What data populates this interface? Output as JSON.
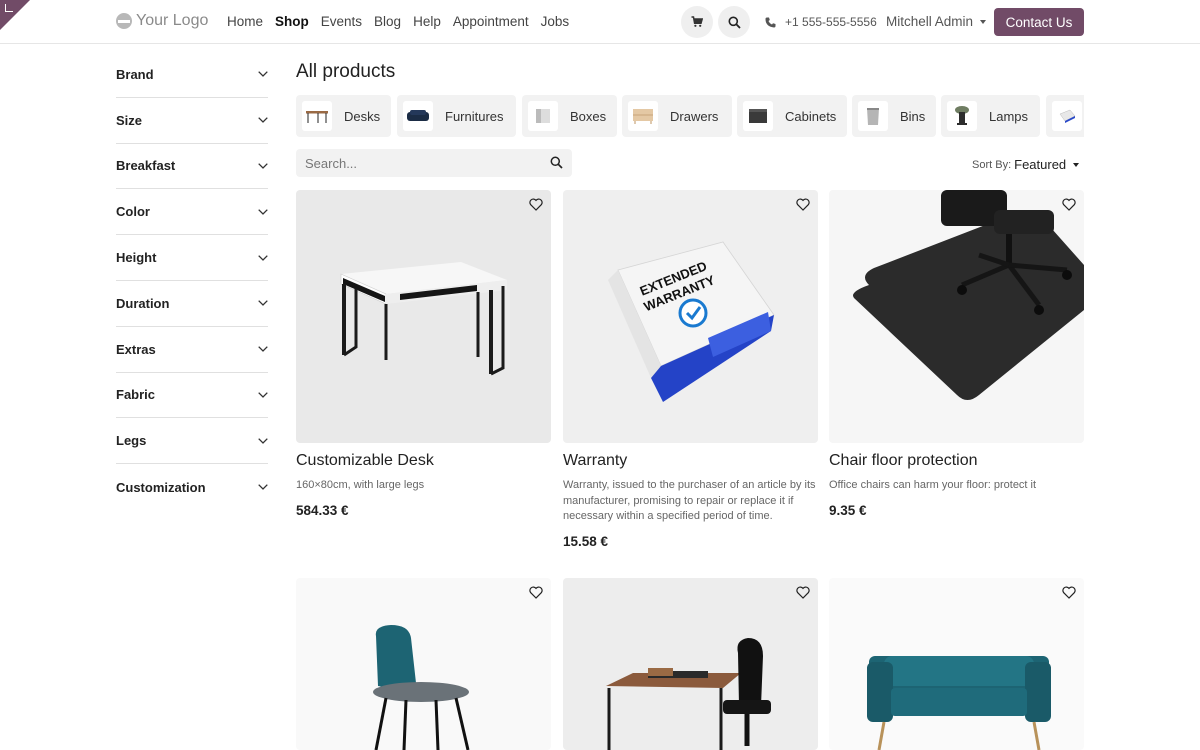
{
  "header": {
    "logo_text": "Your Logo",
    "nav": [
      "Home",
      "Shop",
      "Events",
      "Blog",
      "Help",
      "Appointment",
      "Jobs"
    ],
    "active_nav": "Shop",
    "phone": "+1 555-555-5556",
    "user": "Mitchell Admin",
    "contact_label": "Contact Us"
  },
  "filters": [
    "Brand",
    "Size",
    "Breakfast",
    "Color",
    "Height",
    "Duration",
    "Extras",
    "Fabric",
    "Legs",
    "Customization"
  ],
  "page_title": "All products",
  "categories": [
    "Desks",
    "Furnitures",
    "Boxes",
    "Drawers",
    "Cabinets",
    "Bins",
    "Lamps"
  ],
  "search": {
    "placeholder": "Search..."
  },
  "sort": {
    "label": "Sort By:",
    "value": "Featured"
  },
  "products": [
    {
      "name": "Customizable Desk",
      "desc": "160×80cm, with large legs",
      "price": "584.33 €"
    },
    {
      "name": "Warranty",
      "desc": "Warranty, issued to the purchaser of an article by its manufacturer, promising to repair or replace it if necessary within a specified period of time.",
      "price": "15.58 €"
    },
    {
      "name": "Chair floor protection",
      "desc": "Office chairs can harm your floor: protect it",
      "price": "9.35 €"
    }
  ],
  "box_text": [
    "EXTENDED",
    "WARRANTY"
  ],
  "colors": {
    "accent": "#714b67",
    "teal": "#1d6473"
  }
}
